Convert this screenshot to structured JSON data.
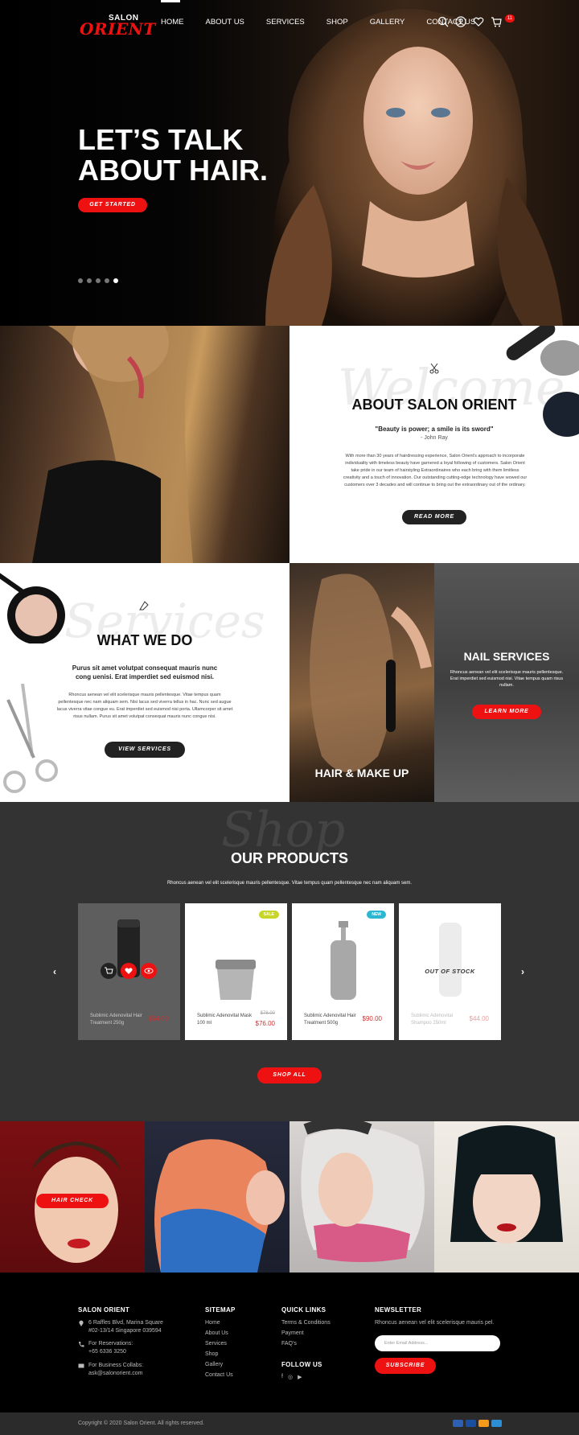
{
  "brand": {
    "name_top": "SALON",
    "name_main": "ORIENT",
    "accent": "#ee1111"
  },
  "nav": {
    "links": [
      "HOME",
      "ABOUT US",
      "SERVICES",
      "SHOP",
      "GALLERY",
      "CONTACT US"
    ],
    "cart_count": "11"
  },
  "hero": {
    "title": "LET’S TALK ABOUT HAIR.",
    "button": "GET STARTED",
    "slides_total": 5,
    "slide_active": 5
  },
  "about": {
    "script": "Welcome",
    "title": "ABOUT SALON ORIENT",
    "quote": "\"Beauty is power; a smile is its sword\"",
    "author": "- John Ray",
    "body": "With more than 30 years of hairdressing experience, Salon Orient's approach to incorporate individuality with timeless beauty have garnered a loyal following of customers. Salon Orient take pride in our team of hairstyling Extraordinaires who each bring with them limitless creativity and a touch of innovation. Our outstanding cutting-edge technology have wowed our customers over 3 decades and will continue to bring out the extraordinary out of the ordinary.",
    "button": "READ MORE"
  },
  "what_we_do": {
    "script": "Services",
    "title": "WHAT WE DO",
    "subtitle": "Purus sit amet volutpat consequat mauris nunc cong uenisi. Erat imperdiet sed euismod nisi.",
    "body": "Rhoncus aenean vel elit scelerisque mauris pellentesque. Vitae tempus quam pellentesque nec nam aliquam sem. Nisi lacus sed viverra tellus in hac. Nunc sed augue lacus viverra vitae congue eu. Erat imperdiet sed euismod nisi porta. Ullamcorper sit amet risus nullam. Purus sit amet volutpat consequat mauris nunc congue nisi.",
    "button": "VIEW SERVICES"
  },
  "tiles": {
    "hair_label": "HAIR & MAKE UP",
    "nail_title": "NAIL SERVICES",
    "nail_desc": "Rhoncus aenean vel elit scelerisque mauris pellentesque. Erat imperdiet sed euismod nisi. Vitae tempus quam risus nullam.",
    "nail_button": "LEARN MORE"
  },
  "products": {
    "script": "Shop",
    "title": "OUR PRODUCTS",
    "subtitle": "Rhoncus aenean vel elit scelerisque mauris pellentesque. Vitae tempus quam pellentesque nec nam aliquam sem.",
    "items": [
      {
        "name": "Sublimic Adenovital Hair Treatment 250g",
        "price": "$54.00",
        "old_price": "",
        "badge": "",
        "state": "hover"
      },
      {
        "name": "Sublimic Adenovital Mask 100 ml",
        "price": "$76.00",
        "old_price": "$78.00",
        "badge": "SALE",
        "state": ""
      },
      {
        "name": "Sublimic Adenovital Hair Treatment 500g",
        "price": "$90.00",
        "old_price": "",
        "badge": "NEW",
        "state": ""
      },
      {
        "name": "Sublimic Adenovital Shampoo 250ml",
        "price": "$44.00",
        "old_price": "",
        "badge": "",
        "state": "out_of_stock"
      }
    ],
    "out_of_stock_label": "OUT OF STOCK",
    "sale_color": "#c8d62a",
    "new_color": "#2bb6d1",
    "button": "SHOP ALL"
  },
  "gallery": {
    "button": "HAIR CHECK"
  },
  "footer": {
    "brand_heading": "SALON ORIENT",
    "address": [
      "6 Raffles Blvd, Marina Square",
      "#02-13/14 Singapore 039594"
    ],
    "reservations": [
      "For Reservations:",
      "+65 6336 3250"
    ],
    "collabs": [
      "For Business Collabs:",
      "ask@salonorient.com"
    ],
    "sitemap_heading": "SITEMAP",
    "sitemap": [
      "Home",
      "About Us",
      "Services",
      "Shop",
      "Gallery",
      "Contact Us"
    ],
    "quick_heading": "QUICK LINKS",
    "quick": [
      "Terms & Conditions",
      "Payment",
      "FAQ's"
    ],
    "follow_heading": "FOLLOW US",
    "newsletter_heading": "NEWSLETTER",
    "newsletter_text": "Rhoncus aenean vel elit scelerisque mauris pel.",
    "newsletter_placeholder": "Enter Email Address...",
    "newsletter_button": "SUBSCRIBE",
    "copyright": "Copyright © 2020 Salon Orient. All rights reserved."
  }
}
